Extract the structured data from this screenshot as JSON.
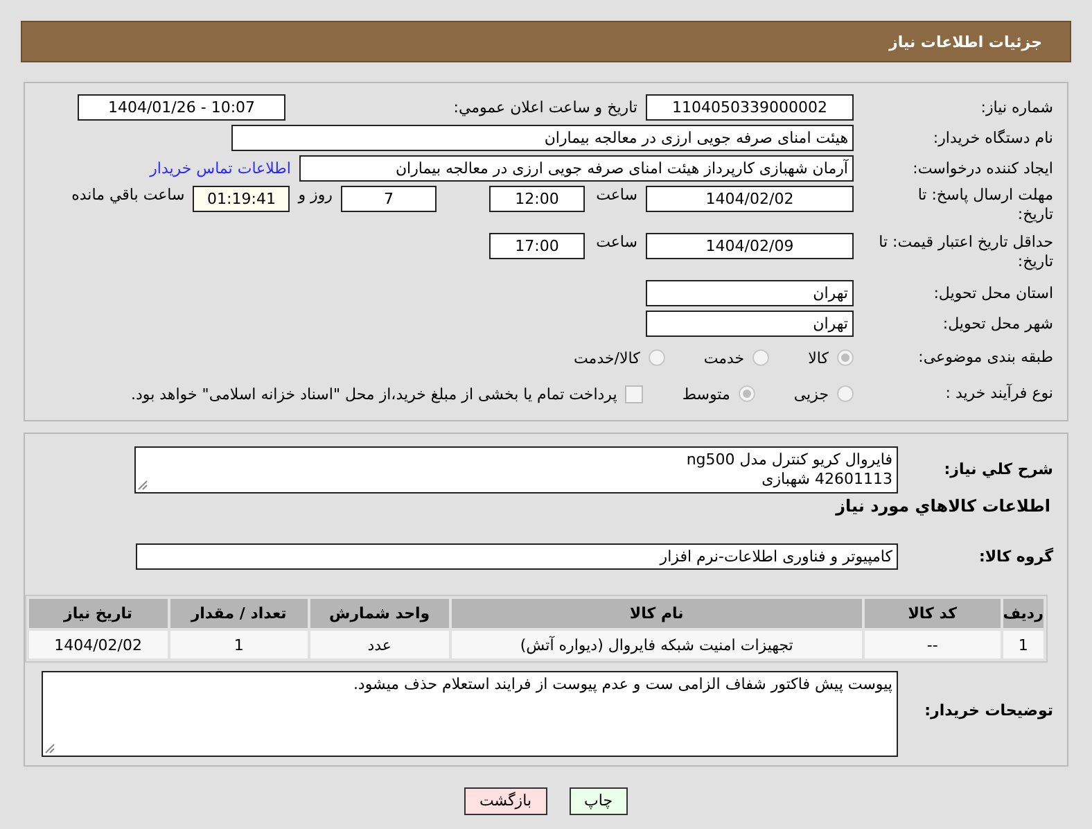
{
  "header": {
    "title": "جزئیات اطلاعات نیاز"
  },
  "need_number": {
    "label": "شماره نیاز:",
    "value": "1104050339000002"
  },
  "announce": {
    "label": "تاریخ و ساعت اعلان عمومي:",
    "value": "1404/01/26 - 10:07"
  },
  "buyer_org": {
    "label": "نام دستگاه خریدار:",
    "value": "هیئت امنای صرفه جویی ارزی در معالجه بیماران"
  },
  "requester": {
    "label": "ایجاد کننده درخواست:",
    "value": "آرمان شهبازی کارپرداز هیئت امنای صرفه جویی ارزی در معالجه بیماران",
    "link": "اطلاعات تماس خریدار"
  },
  "deadline": {
    "label": "مهلت ارسال پاسخ: تا تاریخ:",
    "date": "1404/02/02",
    "time_label": "ساعت",
    "time": "12:00",
    "days": "7",
    "days_label": "روز و",
    "remaining": "01:19:41",
    "remaining_label": "ساعت باقي مانده"
  },
  "validity": {
    "label": "حداقل تاریخ اعتبار قیمت: تا تاریخ:",
    "date": "1404/02/09",
    "time_label": "ساعت",
    "time": "17:00"
  },
  "province": {
    "label": "استان محل تحویل:",
    "value": "تهران"
  },
  "city": {
    "label": "شهر محل تحویل:",
    "value": "تهران"
  },
  "category": {
    "label": "طبقه بندی موضوعی:",
    "options": [
      {
        "label": "کالا",
        "selected": true
      },
      {
        "label": "خدمت",
        "selected": false
      },
      {
        "label": "کالا/خدمت",
        "selected": false
      }
    ]
  },
  "process": {
    "label": "نوع فرآیند خرید :",
    "options": [
      {
        "label": "جزیی",
        "selected": false
      },
      {
        "label": "متوسط",
        "selected": true
      }
    ],
    "treasury": {
      "checked": false,
      "text": "پرداخت تمام یا بخشی از مبلغ خرید،از محل \"اسناد خزانه اسلامی\" خواهد بود."
    }
  },
  "description": {
    "label": "شرح کلي نیاز:",
    "value": "فایروال کریو کنترل مدل ng500\n42601113 شهبازی"
  },
  "goods_heading": "اطلاعات کالاهاي مورد نیاز",
  "goods_group": {
    "label": "گروه کالا:",
    "value": "کامپیوتر و فناوری اطلاعات-نرم افزار"
  },
  "table": {
    "columns": [
      "ردیف",
      "کد کالا",
      "نام کالا",
      "واحد شمارش",
      "تعداد / مقدار",
      "تاریخ نیاز"
    ],
    "rows": [
      [
        "1",
        "--",
        "تجهیزات امنیت شبکه فایروال (دیواره آتش)",
        "عدد",
        "1",
        "1404/02/02"
      ]
    ]
  },
  "buyer_notes": {
    "label": "توضیحات خریدار:",
    "value": "پیوست پیش فاکتور شفاف الزامی ست و عدم پیوست از فرایند استعلام حذف میشود."
  },
  "buttons": [
    {
      "label": "چاپ",
      "kind": "print"
    },
    {
      "label": "بازگشت",
      "kind": "back"
    }
  ]
}
